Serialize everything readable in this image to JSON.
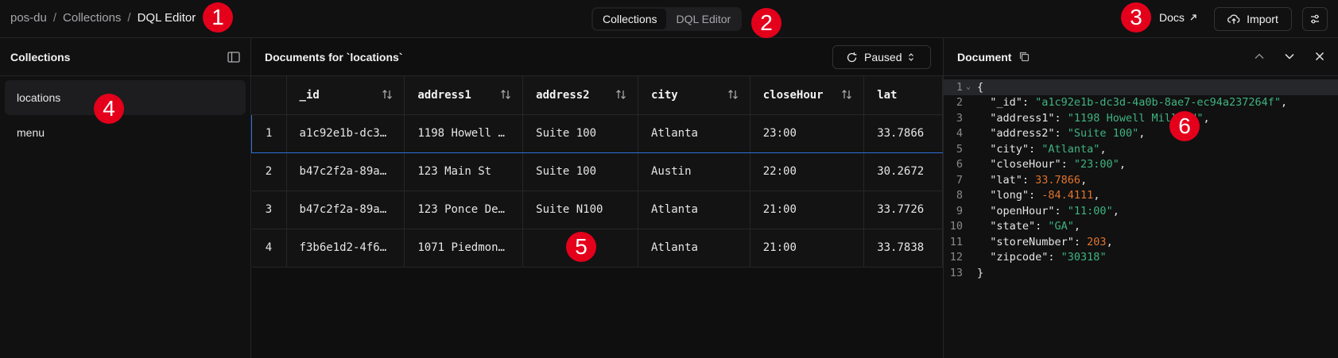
{
  "breadcrumb": [
    "pos-du",
    "Collections",
    "DQL Editor"
  ],
  "view_switch": {
    "options": [
      "Collections",
      "DQL Editor"
    ],
    "active": "Collections"
  },
  "header_actions": {
    "docs": "Docs",
    "import": "Import"
  },
  "collections_panel": {
    "title": "Collections",
    "items": [
      "locations",
      "menu"
    ],
    "active": "locations"
  },
  "documents_panel": {
    "title": "Documents for `locations`",
    "paused_label": "Paused",
    "columns": [
      "_id",
      "address1",
      "address2",
      "city",
      "closeHour",
      "lat"
    ],
    "rows": [
      {
        "num": "1",
        "cells": [
          "a1c92e1b-dc3…",
          "1198 Howell …",
          "Suite 100",
          "Atlanta",
          "23:00",
          "33.7866"
        ]
      },
      {
        "num": "2",
        "cells": [
          "b47c2f2a-89a…",
          "123 Main St",
          "Suite 100",
          "Austin",
          "22:00",
          "30.2672"
        ]
      },
      {
        "num": "3",
        "cells": [
          "b47c2f2a-89a…",
          "123 Ponce De…",
          "Suite N100",
          "Atlanta",
          "21:00",
          "33.7726"
        ]
      },
      {
        "num": "4",
        "cells": [
          "f3b6e1d2-4f6…",
          "1071 Piedmon…",
          "",
          "Atlanta",
          "21:00",
          "33.7838"
        ]
      }
    ]
  },
  "document_panel": {
    "title": "Document",
    "lines": [
      {
        "n": "1",
        "parts": [
          [
            "k",
            "{"
          ]
        ]
      },
      {
        "n": "2",
        "parts": [
          [
            "k",
            "  \"_id\": "
          ],
          [
            "s",
            "\"a1c92e1b-dc3d-4a0b-8ae7-ec94a237264f\""
          ],
          [
            "k",
            ","
          ]
        ]
      },
      {
        "n": "3",
        "parts": [
          [
            "k",
            "  \"address1\": "
          ],
          [
            "s",
            "\"1198 Howell Mill Rd\""
          ],
          [
            "k",
            ","
          ]
        ]
      },
      {
        "n": "4",
        "parts": [
          [
            "k",
            "  \"address2\": "
          ],
          [
            "s",
            "\"Suite 100\""
          ],
          [
            "k",
            ","
          ]
        ]
      },
      {
        "n": "5",
        "parts": [
          [
            "k",
            "  \"city\": "
          ],
          [
            "s",
            "\"Atlanta\""
          ],
          [
            "k",
            ","
          ]
        ]
      },
      {
        "n": "6",
        "parts": [
          [
            "k",
            "  \"closeHour\": "
          ],
          [
            "s",
            "\"23:00\""
          ],
          [
            "k",
            ","
          ]
        ]
      },
      {
        "n": "7",
        "parts": [
          [
            "k",
            "  \"lat\": "
          ],
          [
            "n",
            "33.7866"
          ],
          [
            "k",
            ","
          ]
        ]
      },
      {
        "n": "8",
        "parts": [
          [
            "k",
            "  \"long\": "
          ],
          [
            "n",
            "-84.4111"
          ],
          [
            "k",
            ","
          ]
        ]
      },
      {
        "n": "9",
        "parts": [
          [
            "k",
            "  \"openHour\": "
          ],
          [
            "s",
            "\"11:00\""
          ],
          [
            "k",
            ","
          ]
        ]
      },
      {
        "n": "10",
        "parts": [
          [
            "k",
            "  \"state\": "
          ],
          [
            "s",
            "\"GA\""
          ],
          [
            "k",
            ","
          ]
        ]
      },
      {
        "n": "11",
        "parts": [
          [
            "k",
            "  \"storeNumber\": "
          ],
          [
            "n",
            "203"
          ],
          [
            "k",
            ","
          ]
        ]
      },
      {
        "n": "12",
        "parts": [
          [
            "k",
            "  \"zipcode\": "
          ],
          [
            "s",
            "\"30318\""
          ]
        ]
      },
      {
        "n": "13",
        "parts": [
          [
            "k",
            "}"
          ]
        ]
      }
    ]
  },
  "markers": [
    "1",
    "2",
    "3",
    "4",
    "5",
    "6"
  ],
  "colors": {
    "selection": "#2d6fd6",
    "string": "#3fb37f",
    "number": "#e0742c",
    "marker": "#e4001b"
  }
}
